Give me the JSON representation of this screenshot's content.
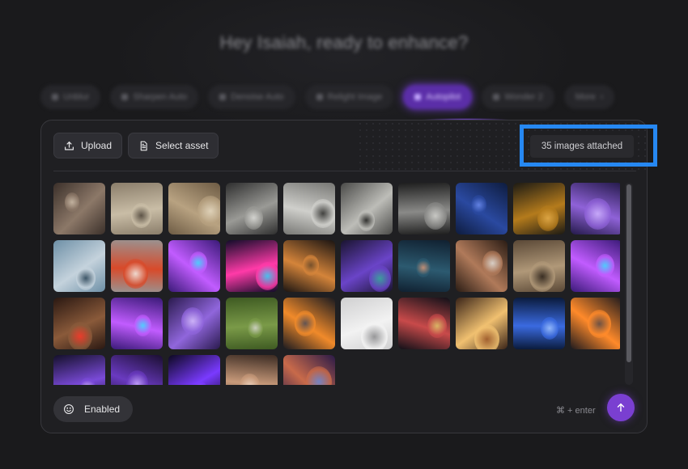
{
  "greeting": "Hey Isaiah, ready to enhance?",
  "modes": [
    {
      "label": "Unblur",
      "active": false
    },
    {
      "label": "Sharpen Auto",
      "active": false
    },
    {
      "label": "Denoise Auto",
      "active": false
    },
    {
      "label": "Relight Image",
      "active": false
    },
    {
      "label": "Autopilot",
      "active": true
    },
    {
      "label": "Wonder 2",
      "active": false
    },
    {
      "label": "More",
      "active": false
    }
  ],
  "toolbar": {
    "upload_label": "Upload",
    "select_asset_label": "Select asset"
  },
  "attached_text": "35 images attached",
  "enabled_label": "Enabled",
  "shortcut_text": "⌘ + enter",
  "colors": {
    "accent": "#7a3fd1",
    "highlight": "#2688f2",
    "panel": "#1f1f22",
    "background": "#1a1a1c"
  },
  "images": [
    {
      "subject": "vintage-victorian-women",
      "palette": [
        "#3b302a",
        "#8c7868",
        "#d0c0ac"
      ]
    },
    {
      "subject": "vintage-horse-carriage",
      "palette": [
        "#8a7d6a",
        "#c9bda6",
        "#4c4338"
      ]
    },
    {
      "subject": "vintage-two-girls",
      "palette": [
        "#6d5b44",
        "#b8a281",
        "#e8dcc4"
      ]
    },
    {
      "subject": "vintage-child-fence",
      "palette": [
        "#2e2e2e",
        "#9a9a96",
        "#e0e0dc"
      ]
    },
    {
      "subject": "vintage-man-hat",
      "palette": [
        "#777774",
        "#cfcfcb",
        "#2a2a28"
      ]
    },
    {
      "subject": "vintage-group-photo",
      "palette": [
        "#4a4a48",
        "#bdbdb8",
        "#1e1e1c"
      ]
    },
    {
      "subject": "vintage-woman-portrait",
      "palette": [
        "#1e1e1e",
        "#8a8a88",
        "#d6d6d2"
      ]
    },
    {
      "subject": "underwater-diver",
      "palette": [
        "#0e1c3e",
        "#2a49a0",
        "#6c8cf0"
      ]
    },
    {
      "subject": "bee-flight",
      "palette": [
        "#1c1a14",
        "#b47b1c",
        "#eab04a"
      ]
    },
    {
      "subject": "purple-flower",
      "palette": [
        "#241a4a",
        "#8f62d8",
        "#d0b4ff"
      ]
    },
    {
      "subject": "ocean-horizon",
      "palette": [
        "#6d8fa6",
        "#c4d2dc",
        "#2b4456"
      ]
    },
    {
      "subject": "kart-racing",
      "palette": [
        "#9a9290",
        "#d84a2a",
        "#f4efe8"
      ]
    },
    {
      "subject": "neon-motorcycle",
      "palette": [
        "#3a1a78",
        "#c15cff",
        "#40e0ff"
      ]
    },
    {
      "subject": "neon-city-street",
      "palette": [
        "#120c2a",
        "#ff3aa8",
        "#3ad8ff"
      ]
    },
    {
      "subject": "sports-car-night",
      "palette": [
        "#1a1412",
        "#d4843a",
        "#6a4a2a"
      ]
    },
    {
      "subject": "hummingbird-purple",
      "palette": [
        "#1a1430",
        "#6a44c8",
        "#3ab0a0"
      ]
    },
    {
      "subject": "woman-rainy-car",
      "palette": [
        "#102030",
        "#2c5a70",
        "#d89878"
      ]
    },
    {
      "subject": "old-man-portrait",
      "palette": [
        "#2a1c14",
        "#b07a5a",
        "#e6e2dc"
      ]
    },
    {
      "subject": "desert-veiled-woman",
      "palette": [
        "#5a4836",
        "#b09878",
        "#2a2018"
      ]
    },
    {
      "subject": "neon-motorcycle-2",
      "palette": [
        "#3a1a78",
        "#c15cff",
        "#40e0ff"
      ]
    },
    {
      "subject": "red-eyed-creature",
      "palette": [
        "#2a1812",
        "#8a5a3a",
        "#ff3a2a"
      ]
    },
    {
      "subject": "neon-motorcycle-3",
      "palette": [
        "#3a1a78",
        "#c15cff",
        "#40e0ff"
      ]
    },
    {
      "subject": "purple-flower-2",
      "palette": [
        "#2a1a4e",
        "#9066dc",
        "#d8c0ff"
      ]
    },
    {
      "subject": "green-board-object",
      "palette": [
        "#3e5a22",
        "#7a9a48",
        "#d8d8d0"
      ]
    },
    {
      "subject": "dragon-fire",
      "palette": [
        "#1a1a20",
        "#f08a2a",
        "#4a4a58"
      ]
    },
    {
      "subject": "white-gallery-room",
      "palette": [
        "#cfcfd0",
        "#f2f2f2",
        "#8a8a8c"
      ]
    },
    {
      "subject": "times-square-night",
      "palette": [
        "#101018",
        "#c84a4a",
        "#e0c86a"
      ]
    },
    {
      "subject": "race-track-sunset",
      "palette": [
        "#3a2418",
        "#f0c070",
        "#a05a2a"
      ]
    },
    {
      "subject": "blue-glowing-eye",
      "palette": [
        "#0a1a3a",
        "#3a6ae0",
        "#a0c4ff"
      ]
    },
    {
      "subject": "dragon-fire-2",
      "palette": [
        "#1e1a1e",
        "#ff8a2a",
        "#5a4a48"
      ]
    },
    {
      "subject": "purple-lily",
      "palette": [
        "#14102a",
        "#7a4ad8",
        "#e0c8ff"
      ]
    },
    {
      "subject": "astronaut-purple",
      "palette": [
        "#1a0e30",
        "#6a3ac0",
        "#c8a8ff"
      ]
    },
    {
      "subject": "black-hole",
      "palette": [
        "#0c0820",
        "#7a3aff",
        "#c890ff"
      ]
    },
    {
      "subject": "woman-portrait",
      "palette": [
        "#3a2a22",
        "#c89a7a",
        "#f0d8c4"
      ]
    },
    {
      "subject": "fantasy-battle",
      "palette": [
        "#2a1a48",
        "#c86a4a",
        "#6a8ad8"
      ]
    }
  ]
}
